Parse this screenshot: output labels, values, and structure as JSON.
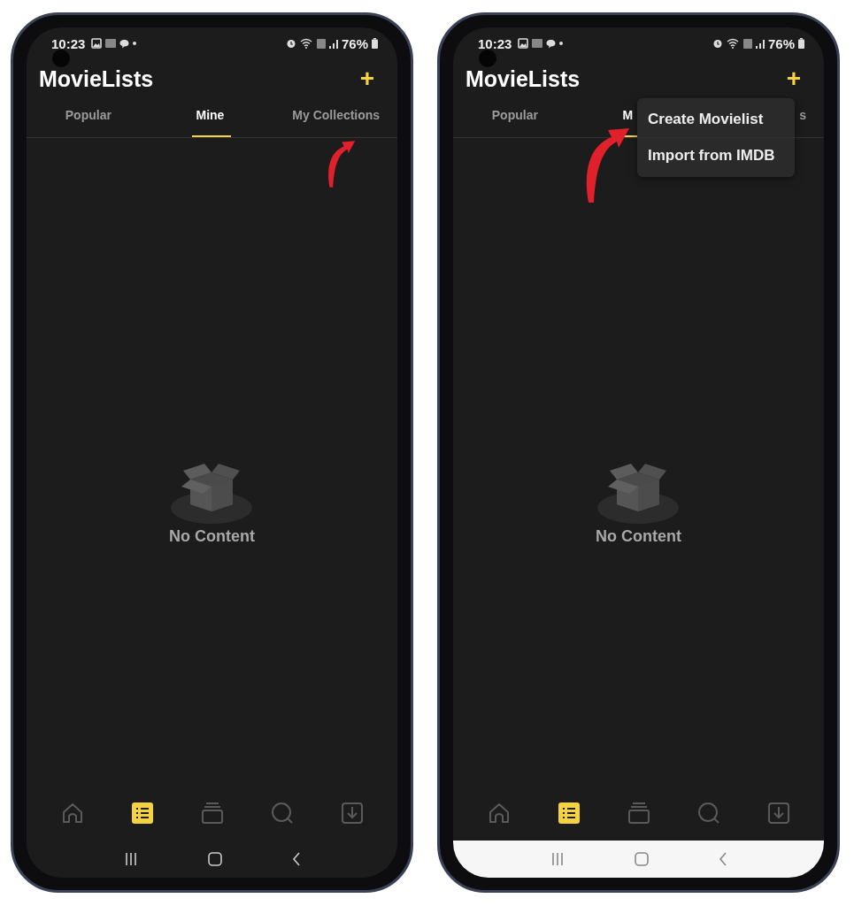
{
  "phones": [
    {
      "status_bar": {
        "time": "10:23",
        "battery": "76%"
      },
      "header": {
        "title": "MovieLists",
        "add_button": "+"
      },
      "tabs": [
        {
          "label": "Popular",
          "selected": false
        },
        {
          "label": "Mine",
          "selected": true
        },
        {
          "label": "My Collections",
          "selected": false
        }
      ],
      "empty_state": {
        "message": "No Content"
      },
      "bottom_nav": [
        {
          "kind": "home",
          "selected": false
        },
        {
          "kind": "lists",
          "selected": true
        },
        {
          "kind": "library",
          "selected": false
        },
        {
          "kind": "search",
          "selected": false
        },
        {
          "kind": "downloads",
          "selected": false
        }
      ],
      "system_nav": {
        "light": false
      }
    },
    {
      "status_bar": {
        "time": "10:23",
        "battery": "76%"
      },
      "header": {
        "title": "MovieLists",
        "add_button": "+"
      },
      "tabs": [
        {
          "label": "Popular",
          "selected": false
        },
        {
          "label": "M",
          "selected": true
        },
        {
          "label": "s",
          "selected": false
        }
      ],
      "menu": {
        "items": [
          "Create Movielist",
          "Import from IMDB"
        ]
      },
      "empty_state": {
        "message": "No Content"
      },
      "bottom_nav": [
        {
          "kind": "home",
          "selected": false
        },
        {
          "kind": "lists",
          "selected": true
        },
        {
          "kind": "library",
          "selected": false
        },
        {
          "kind": "search",
          "selected": false
        },
        {
          "kind": "downloads",
          "selected": false
        }
      ],
      "system_nav": {
        "light": true
      }
    }
  ]
}
